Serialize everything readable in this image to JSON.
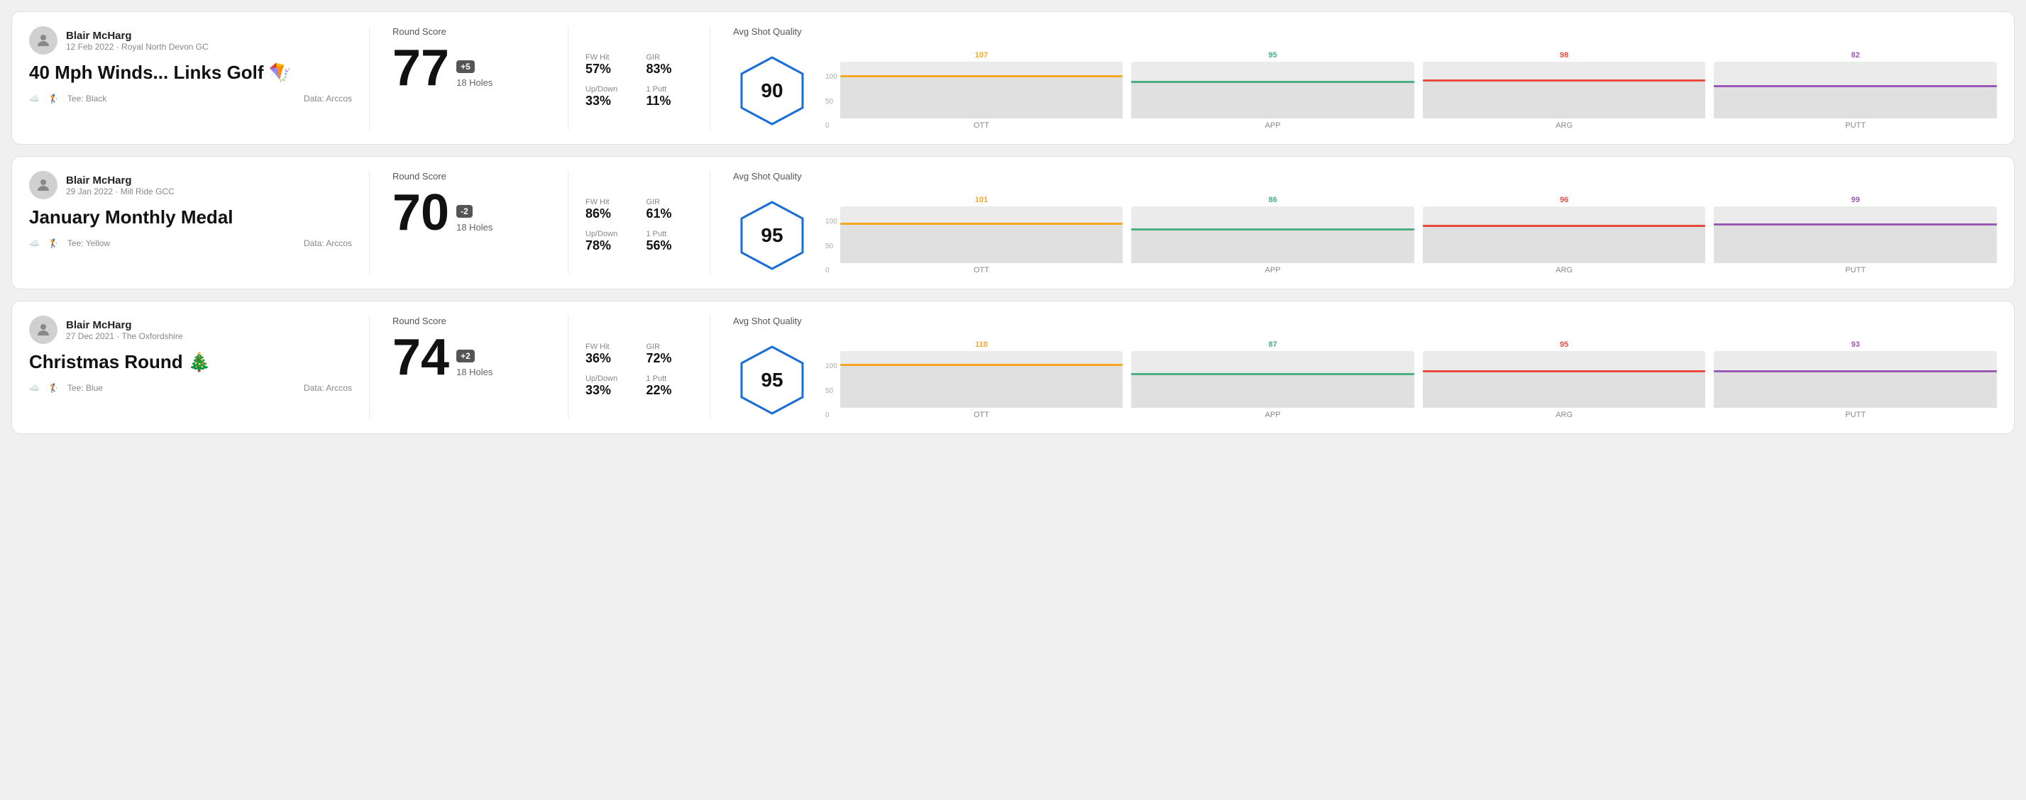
{
  "rounds": [
    {
      "id": "round-1",
      "user_name": "Blair McHarg",
      "user_meta": "12 Feb 2022 · Royal North Devon GC",
      "title": "40 Mph Winds... Links Golf 🪁",
      "tee": "Black",
      "data_source": "Data: Arccos",
      "round_score_label": "Round Score",
      "score": "77",
      "score_diff": "+5",
      "holes": "18 Holes",
      "fw_hit_label": "FW Hit",
      "fw_hit_value": "57%",
      "gir_label": "GIR",
      "gir_value": "83%",
      "updown_label": "Up/Down",
      "updown_value": "33%",
      "oneputt_label": "1 Putt",
      "oneputt_value": "11%",
      "avg_quality_label": "Avg Shot Quality",
      "quality_score": "90",
      "chart": {
        "ott": {
          "label": "OTT",
          "value": 107,
          "color": "#f5a623",
          "bar_pct": 72
        },
        "app": {
          "label": "APP",
          "value": 95,
          "color": "#4caf82",
          "bar_pct": 63
        },
        "arg": {
          "label": "ARG",
          "value": 98,
          "color": "#e74c3c",
          "bar_pct": 65
        },
        "putt": {
          "label": "PUTT",
          "value": 82,
          "color": "#9b59b6",
          "bar_pct": 55
        }
      }
    },
    {
      "id": "round-2",
      "user_name": "Blair McHarg",
      "user_meta": "29 Jan 2022 · Mill Ride GCC",
      "title": "January Monthly Medal",
      "tee": "Yellow",
      "data_source": "Data: Arccos",
      "round_score_label": "Round Score",
      "score": "70",
      "score_diff": "-2",
      "holes": "18 Holes",
      "fw_hit_label": "FW Hit",
      "fw_hit_value": "86%",
      "gir_label": "GIR",
      "gir_value": "61%",
      "updown_label": "Up/Down",
      "updown_value": "78%",
      "oneputt_label": "1 Putt",
      "oneputt_value": "56%",
      "avg_quality_label": "Avg Shot Quality",
      "quality_score": "95",
      "chart": {
        "ott": {
          "label": "OTT",
          "value": 101,
          "color": "#f5a623",
          "bar_pct": 68
        },
        "app": {
          "label": "APP",
          "value": 86,
          "color": "#4caf82",
          "bar_pct": 57
        },
        "arg": {
          "label": "ARG",
          "value": 96,
          "color": "#e74c3c",
          "bar_pct": 64
        },
        "putt": {
          "label": "PUTT",
          "value": 99,
          "color": "#9b59b6",
          "bar_pct": 66
        }
      }
    },
    {
      "id": "round-3",
      "user_name": "Blair McHarg",
      "user_meta": "27 Dec 2021 · The Oxfordshire",
      "title": "Christmas Round 🎄",
      "tee": "Blue",
      "data_source": "Data: Arccos",
      "round_score_label": "Round Score",
      "score": "74",
      "score_diff": "+2",
      "holes": "18 Holes",
      "fw_hit_label": "FW Hit",
      "fw_hit_value": "36%",
      "gir_label": "GIR",
      "gir_value": "72%",
      "updown_label": "Up/Down",
      "updown_value": "33%",
      "oneputt_label": "1 Putt",
      "oneputt_value": "22%",
      "avg_quality_label": "Avg Shot Quality",
      "quality_score": "95",
      "chart": {
        "ott": {
          "label": "OTT",
          "value": 110,
          "color": "#f5a623",
          "bar_pct": 74
        },
        "app": {
          "label": "APP",
          "value": 87,
          "color": "#4caf82",
          "bar_pct": 58
        },
        "arg": {
          "label": "ARG",
          "value": 95,
          "color": "#e74c3c",
          "bar_pct": 63
        },
        "putt": {
          "label": "PUTT",
          "value": 93,
          "color": "#9b59b6",
          "bar_pct": 62
        }
      }
    }
  ]
}
